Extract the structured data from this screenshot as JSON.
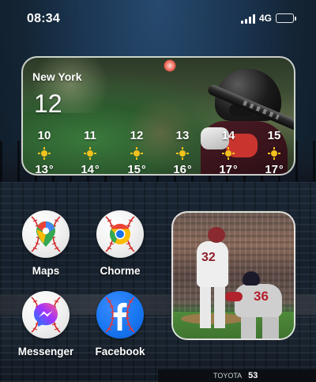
{
  "status_bar": {
    "time": "08:34",
    "network": "4G",
    "battery_color": "#f4d21a"
  },
  "weather_widget": {
    "city": "New York",
    "current_temp": "12",
    "forecast": [
      {
        "hour": "10",
        "icon": "sun-icon",
        "temp": "13"
      },
      {
        "hour": "11",
        "icon": "sun-icon",
        "temp": "14"
      },
      {
        "hour": "12",
        "icon": "sun-icon",
        "temp": "15"
      },
      {
        "hour": "13",
        "icon": "sun-icon",
        "temp": "16"
      },
      {
        "hour": "14",
        "icon": "sun-icon",
        "temp": "17"
      },
      {
        "hour": "15",
        "icon": "sun-icon",
        "temp": "17"
      }
    ]
  },
  "apps": [
    {
      "label": "Maps",
      "icon": "google-maps-icon"
    },
    {
      "label": "Chorme",
      "icon": "chrome-icon"
    },
    {
      "label": "Messenger",
      "icon": "messenger-icon"
    },
    {
      "label": "Facebook",
      "icon": "facebook-icon"
    }
  ],
  "photo_widget": {
    "pitcher_number": "32",
    "batter_number": "36"
  },
  "background": {
    "sign_text": "TOYOTA",
    "sign_number": "53"
  }
}
